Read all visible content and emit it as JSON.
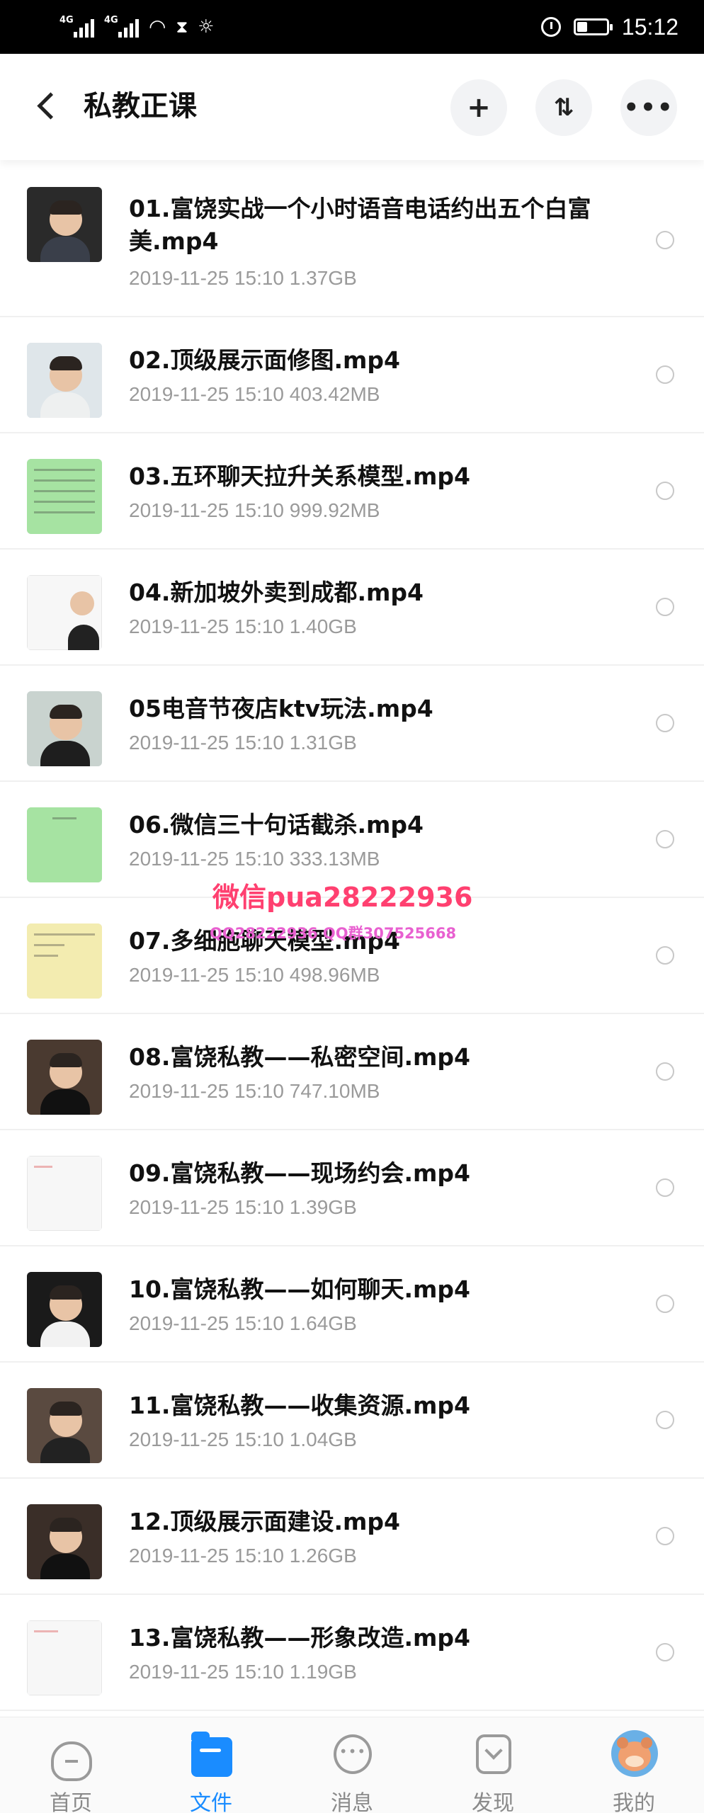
{
  "status_bar": {
    "network_1": "4G",
    "network_2": "4G",
    "time": "15:12",
    "icons": [
      "signal-icon",
      "wifi-icon",
      "hourglass-icon",
      "brightness-icon",
      "alarm-icon",
      "battery-icon"
    ]
  },
  "header": {
    "title": "私教正课",
    "add_icon": "+",
    "sort_icon": "⇅",
    "more_icon": "•••"
  },
  "files": [
    {
      "name": "01.富饶实战一个小时语音电话约出五个白富美.mp4",
      "date": "2019-11-25",
      "time": "15:10",
      "size": "1.37GB"
    },
    {
      "name": "02.顶级展示面修图.mp4",
      "date": "2019-11-25",
      "time": "15:10",
      "size": "403.42MB"
    },
    {
      "name": "03.五环聊天拉升关系模型.mp4",
      "date": "2019-11-25",
      "time": "15:10",
      "size": "999.92MB"
    },
    {
      "name": "04.新加坡外卖到成都.mp4",
      "date": "2019-11-25",
      "time": "15:10",
      "size": "1.40GB"
    },
    {
      "name": "05电音节夜店ktv玩法.mp4",
      "date": "2019-11-25",
      "time": "15:10",
      "size": "1.31GB"
    },
    {
      "name": "06.微信三十句话截杀.mp4",
      "date": "2019-11-25",
      "time": "15:10",
      "size": "333.13MB"
    },
    {
      "name": "07.多细胞聊天模型.mp4",
      "date": "2019-11-25",
      "time": "15:10",
      "size": "498.96MB"
    },
    {
      "name": "08.富饶私教——私密空间.mp4",
      "date": "2019-11-25",
      "time": "15:10",
      "size": "747.10MB"
    },
    {
      "name": "09.富饶私教——现场约会.mp4",
      "date": "2019-11-25",
      "time": "15:10",
      "size": "1.39GB"
    },
    {
      "name": "10.富饶私教——如何聊天.mp4",
      "date": "2019-11-25",
      "time": "15:10",
      "size": "1.64GB"
    },
    {
      "name": "11.富饶私教——收集资源.mp4",
      "date": "2019-11-25",
      "time": "15:10",
      "size": "1.04GB"
    },
    {
      "name": "12.顶级展示面建设.mp4",
      "date": "2019-11-25",
      "time": "15:10",
      "size": "1.26GB"
    },
    {
      "name": "13.富饶私教——形象改造.mp4",
      "date": "2019-11-25",
      "time": "15:10",
      "size": "1.19GB"
    }
  ],
  "watermark": {
    "line1": "微信pua28222936",
    "line2": "QQ28222936 QQ群307525668"
  },
  "bottom_nav": {
    "tabs": [
      {
        "label": "首页",
        "icon": "cloud-icon",
        "active": false
      },
      {
        "label": "文件",
        "icon": "folder-icon",
        "active": true
      },
      {
        "label": "消息",
        "icon": "chat-bubble-icon",
        "active": false
      },
      {
        "label": "发现",
        "icon": "discover-icon",
        "active": false
      },
      {
        "label": "我的",
        "icon": "avatar-icon",
        "active": false
      }
    ]
  },
  "colors": {
    "accent": "#1a8cff",
    "meta_text": "#9a9a9a",
    "watermark_red": "#ff4070",
    "watermark_pink": "#e860d0"
  }
}
